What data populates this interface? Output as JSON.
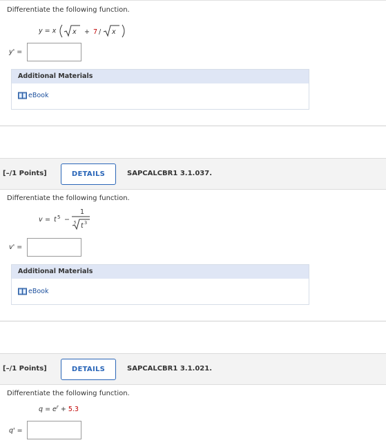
{
  "questions": [
    {
      "prompt": "Differentiate the following function.",
      "equation": {
        "lhs": "y",
        "rhs_prefix": "x",
        "sqrt_term": "x",
        "plus": "+",
        "coef": "7",
        "slash": "/",
        "sqrt_den": "x"
      },
      "answer_label": "y' =",
      "answer_value": "",
      "materials": {
        "header": "Additional Materials",
        "link": "eBook"
      }
    },
    {
      "points": "[–/1 Points]",
      "details_button": "DETAILS",
      "question_id": "SAPCALCBR1 3.1.037.",
      "prompt": "Differentiate the following function.",
      "equation": {
        "lhs": "v",
        "base": "t",
        "exp": "5",
        "minus": "−",
        "num": "1",
        "root_index": "5",
        "rad_base": "t",
        "rad_exp": "3"
      },
      "answer_label": "v' =",
      "answer_value": "",
      "materials": {
        "header": "Additional Materials",
        "link": "eBook"
      }
    },
    {
      "points": "[–/1 Points]",
      "details_button": "DETAILS",
      "question_id": "SAPCALCBR1 3.1.021.",
      "prompt": "Differentiate the following function.",
      "equation": {
        "lhs": "q",
        "base": "e",
        "exp": "r",
        "plus": "+",
        "const": "5.3"
      },
      "answer_label": "q' =",
      "answer_value": ""
    }
  ],
  "colors": {
    "accent": "#2a66b8",
    "red": "#c00000",
    "materials_header": "#dfe6f5",
    "points_bar": "#f3f3f3"
  },
  "icons": {
    "ebook": "book-icon"
  }
}
